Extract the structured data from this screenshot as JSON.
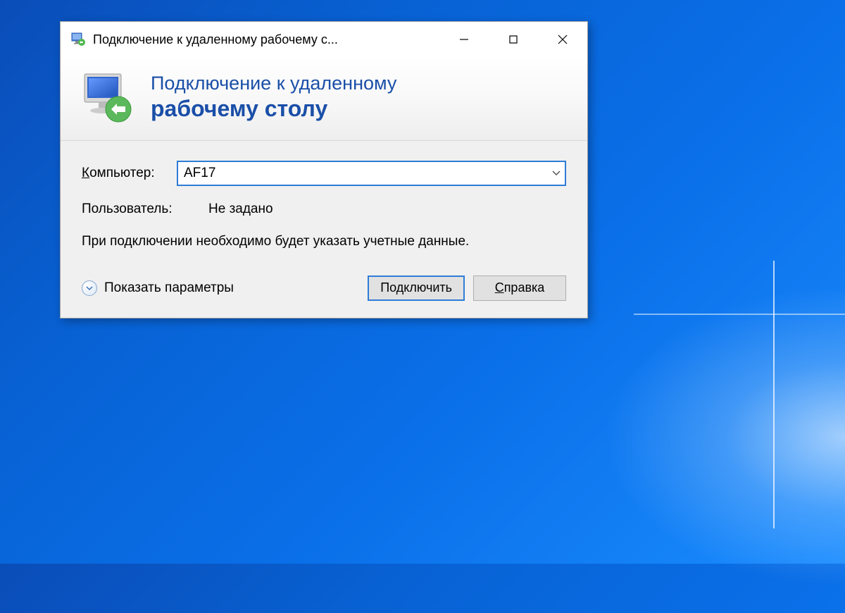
{
  "window": {
    "title": "Подключение к удаленному рабочему с..."
  },
  "header": {
    "line1": "Подключение к удаленному",
    "line2": "рабочему столу"
  },
  "form": {
    "computer_label_prefix": "К",
    "computer_label_rest": "омпьютер:",
    "computer_value": "AF17",
    "user_label": "Пользователь:",
    "user_value": "Не задано",
    "hint": "При подключении необходимо будет указать учетные данные."
  },
  "footer": {
    "show_options_prefix": "П",
    "show_options_rest": "оказать параметры",
    "connect_label": "Подключить",
    "help_label_prefix": "С",
    "help_label_rest": "правка"
  }
}
